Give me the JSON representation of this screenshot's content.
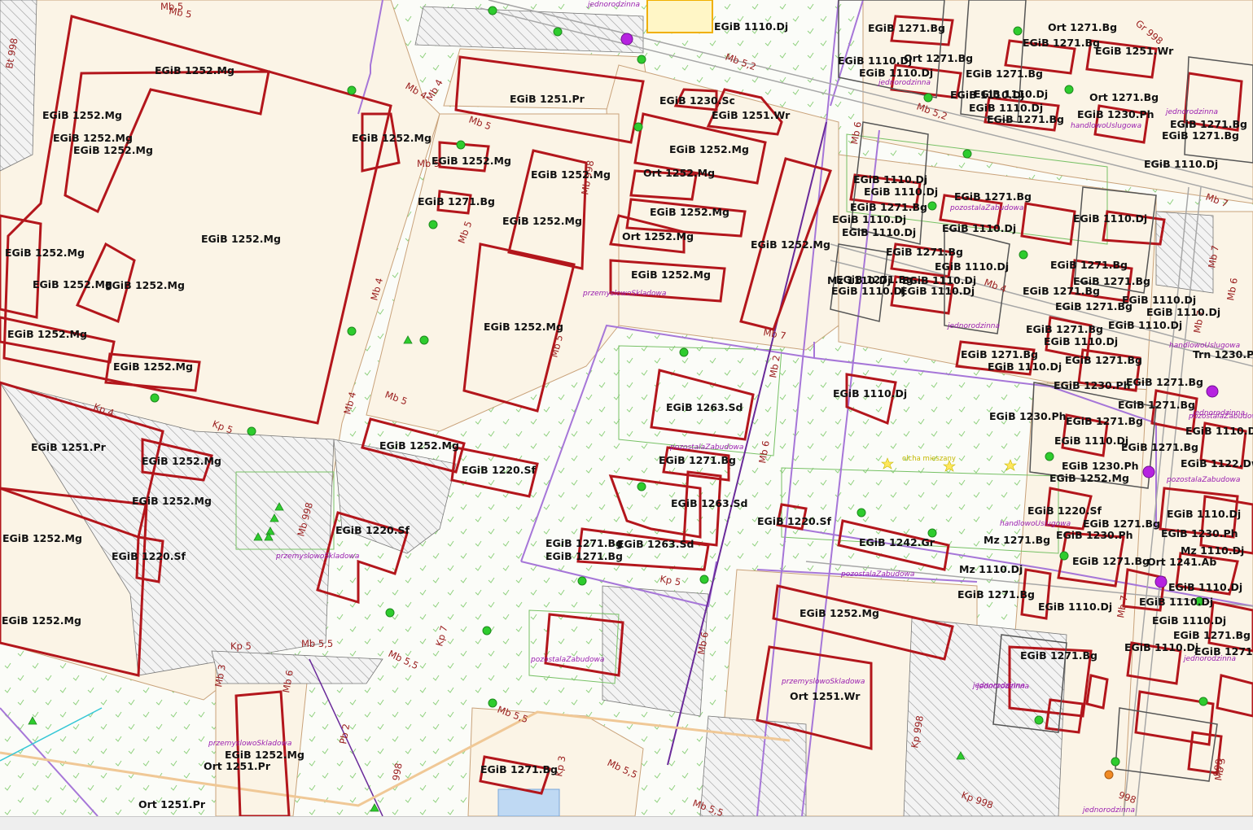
{
  "map": {
    "colors": {
      "background": "#fbfcf8",
      "built_area": "#fbf4e6",
      "building_outline": "#b3161c",
      "plot_line": "#c9a27a",
      "district_line": "#a676d8",
      "green_line": "#77c165",
      "tree": "#2ecc2e",
      "marker": "#b622e0"
    },
    "top_labels": [
      "jednorodzinna"
    ],
    "buildings": [
      "EGiB 1110.Dj",
      "EGiB 1252.Mg",
      "EGiB 1252.Mg",
      "EGiB 1252.Mg",
      "EGiB 1252.Mg",
      "EGiB 1252.Mg",
      "EGiB 1252.Mg",
      "EGiB 1252.Mg",
      "EGiB 1252.Mg",
      "EGiB 1252.Mg",
      "EGiB 1252.Mg",
      "EGiB 1252.Mg",
      "EGiB 1251.Pr",
      "EGiB 1252.Mg",
      "EGiB 1252.Mg",
      "EGiB 1252.Mg",
      "EGiB 1220.Sf",
      "EGiB 1252.Mg",
      "EGiB 1251.Pr",
      "EGiB 1230.Sc",
      "EGiB 1251.Wr",
      "EGiB 1252.Mg",
      "EGiB 1271.Bg",
      "EGiB 1252.Mg",
      "EGiB 1252.Mg",
      "Ort 1252.Mg",
      "EGiB 1252.Mg",
      "Ort 1252.Mg",
      "EGiB 1252.Mg",
      "EGiB 1252.Mg",
      "EGiB 1252.Mg",
      "EGiB 1252.Mg",
      "EGiB 1252.Mg",
      "EGiB 1220.Sf",
      "EGiB 1263.Sd",
      "EGiB 1271.Bg",
      "EGiB 1263.Sd",
      "EGiB 1263.Sd",
      "EGiB 1271.Bg",
      "EGiB 1271.Bg",
      "EGiB 1220.Sf",
      "EGiB 1252.Mg",
      "Ort 1251.Pr",
      "Ort 1251.Pr",
      "EGiB 1271.Bg",
      "EGiB 1220.Sf",
      "EGiB 1242.Gr",
      "EGiB 1110.Dj",
      "EGiB 1252.Mg",
      "Ort 1251.Wr",
      "EGiB 1271.Bg",
      "Ort 1271.Bg",
      "EGiB 1251.Wr",
      "EGiB 1110.Dj",
      "Ort 1271.Bg",
      "EGiB 1110.Dj",
      "EGiB 1271.Bg",
      "EGiB 1271.Bg",
      "EGiB 1110.Dj",
      "Ort 1271.Bg",
      "EGiB 1230.Ph",
      "EGiB 1271.Bg",
      "EGiB 1271.Bg",
      "EGiB 1110.Dj",
      "EGiB 1110.Dj",
      "EGiB 1110.Dj",
      "EGiB 1271.Bg",
      "EGiB 1271.Bg",
      "EGiB 1110.Dj",
      "EGiB 1110.Dj",
      "EGiB 1110.Dj",
      "EGiB 1110.Dj",
      "EGiB 1271.Bg",
      "EGiB 1110.Dj",
      "EGiB 1110.Dj",
      "EGiB 1271.Bg",
      "EGiB 1110.Dj",
      "EGiB 1110.Dj",
      "EGiB 1271.Bg",
      "Mz 1110.Dj",
      "EGiB 1110.Dj",
      "EGiB 1110.Dj",
      "EGiB 1271.Bg",
      "EGiB 1271.Bg",
      "EGiB 1271.Bg",
      "EGiB 1271.Bg",
      "EGiB 1110.Dj",
      "EGiB 1110.Dj",
      "Trn 1230.Ph",
      "EGiB 1110.Dj",
      "EGiB 1271.Bg",
      "EGiB 1110.Dj",
      "EGiB 1271.Bg",
      "EGiB 1110.Dj",
      "EGiB 1271.Bg",
      "EGiB 1230.Ph",
      "EGiB 1271.Bg",
      "EGiB 1271.Bg",
      "EGiB 1230.Ph",
      "EGiB 1271.Bg",
      "EGiB 1110.Dj",
      "EGiB 1271.Bg",
      "EGiB 1122.Dw",
      "EGiB 1110.Dj",
      "EGiB 1230.Ph",
      "EGiB 1252.Mg",
      "EGiB 1220.Sf",
      "EGiB 1271.Bg",
      "EGiB 1110.Dj",
      "EGiB 1230.Ph",
      "Mz 1271.Bg",
      "EGiB 1230.Ph",
      "Mz 1110.Dj",
      "EGiB 1271.Bg",
      "Ort 1241.Ab",
      "Mz 1110.Dj",
      "EGiB 1271.Bg",
      "EGiB 1110.Dj",
      "EGiB 1110.Dj",
      "EGiB 1110.Dj",
      "EGiB 1110.Dj",
      "EGiB 1271.Bg",
      "EGiB 1110.Dj",
      "EGiB 1271.Bg",
      "EGiB 1271.Bg"
    ],
    "road_labels": [
      "Mb 5",
      "Mb 5",
      "Mb 4",
      "Mb 4",
      "Mb 5",
      "Mb 5",
      "Mb 998",
      "Mb 5",
      "Mb 7",
      "Mb 4",
      "Mb 5",
      "Mb 5",
      "Kp 4",
      "Kp 5",
      "Mb 4",
      "Mb 998",
      "Kp 5",
      "Mb 5,5",
      "Mb 5,5",
      "Kp 7",
      "Kp 5",
      "Mb 3",
      "Mb 6",
      "Mb 5,5",
      "Mb 5,5",
      "Mb 6",
      "Mb 6",
      "Mb 5,2",
      "Mb 5,2",
      "Mb 6",
      "Mb 4",
      "Mb 7",
      "Mb 7",
      "Mb 7",
      "Mb 6",
      "Mb 7",
      "Kp 998",
      "Kp 998",
      "Mb 5,5",
      "Kp 3",
      "Pb 2",
      "Mb 3",
      "Bt 998",
      "Mb 2",
      "Gr 998",
      "998",
      "998",
      "998"
    ],
    "use_labels": [
      "przemyslowoSkladowa",
      "pozostalaZabudowa",
      "pozostalaZabudowa",
      "przemyslowoSkladowa",
      "przemyslowoSkladowa",
      "przemyslowoSkladowa",
      "pozostalaZabudowa",
      "pozostalaZabudowa",
      "jednorodzinna",
      "jednorodzinna",
      "handlowoUslugowa",
      "jednorodzinna",
      "handlowoUslugowa",
      "handlowoUslugowa",
      "jednorodzinna",
      "pozostalaZabudowa",
      "pozostalaZabudowa",
      "jednorodzinna",
      "jednorodzinna",
      "jednorodzinna",
      "jednorodzinna"
    ],
    "notes": [
      "olcha mieszany"
    ]
  }
}
